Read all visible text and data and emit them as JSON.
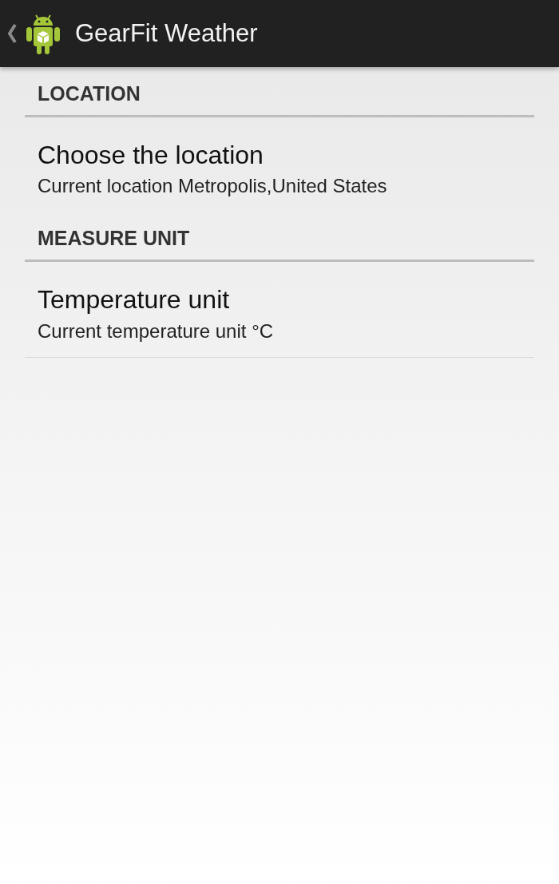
{
  "action_bar": {
    "title": "GearFit Weather"
  },
  "sections": [
    {
      "header": "LOCATION",
      "items": [
        {
          "title": "Choose the location",
          "summary": "Current location Metropolis,United States"
        }
      ]
    },
    {
      "header": "MEASURE UNIT",
      "items": [
        {
          "title": "Temperature unit",
          "summary": "Current temperature unit °C"
        }
      ]
    }
  ]
}
